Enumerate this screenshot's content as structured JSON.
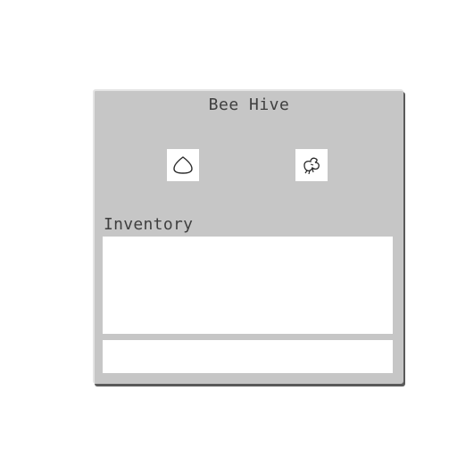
{
  "window": {
    "title": "Bee Hive"
  },
  "slots": [
    {
      "icon": "honey-drop-icon",
      "content": ""
    },
    {
      "icon": "bee-icon",
      "content": ""
    }
  ],
  "inventory": {
    "label": "Inventory"
  },
  "colors": {
    "panel": "#c6c6c6",
    "slot": "#ffffff",
    "text": "#3f3f3f",
    "shadow": "#5a5a5a"
  }
}
